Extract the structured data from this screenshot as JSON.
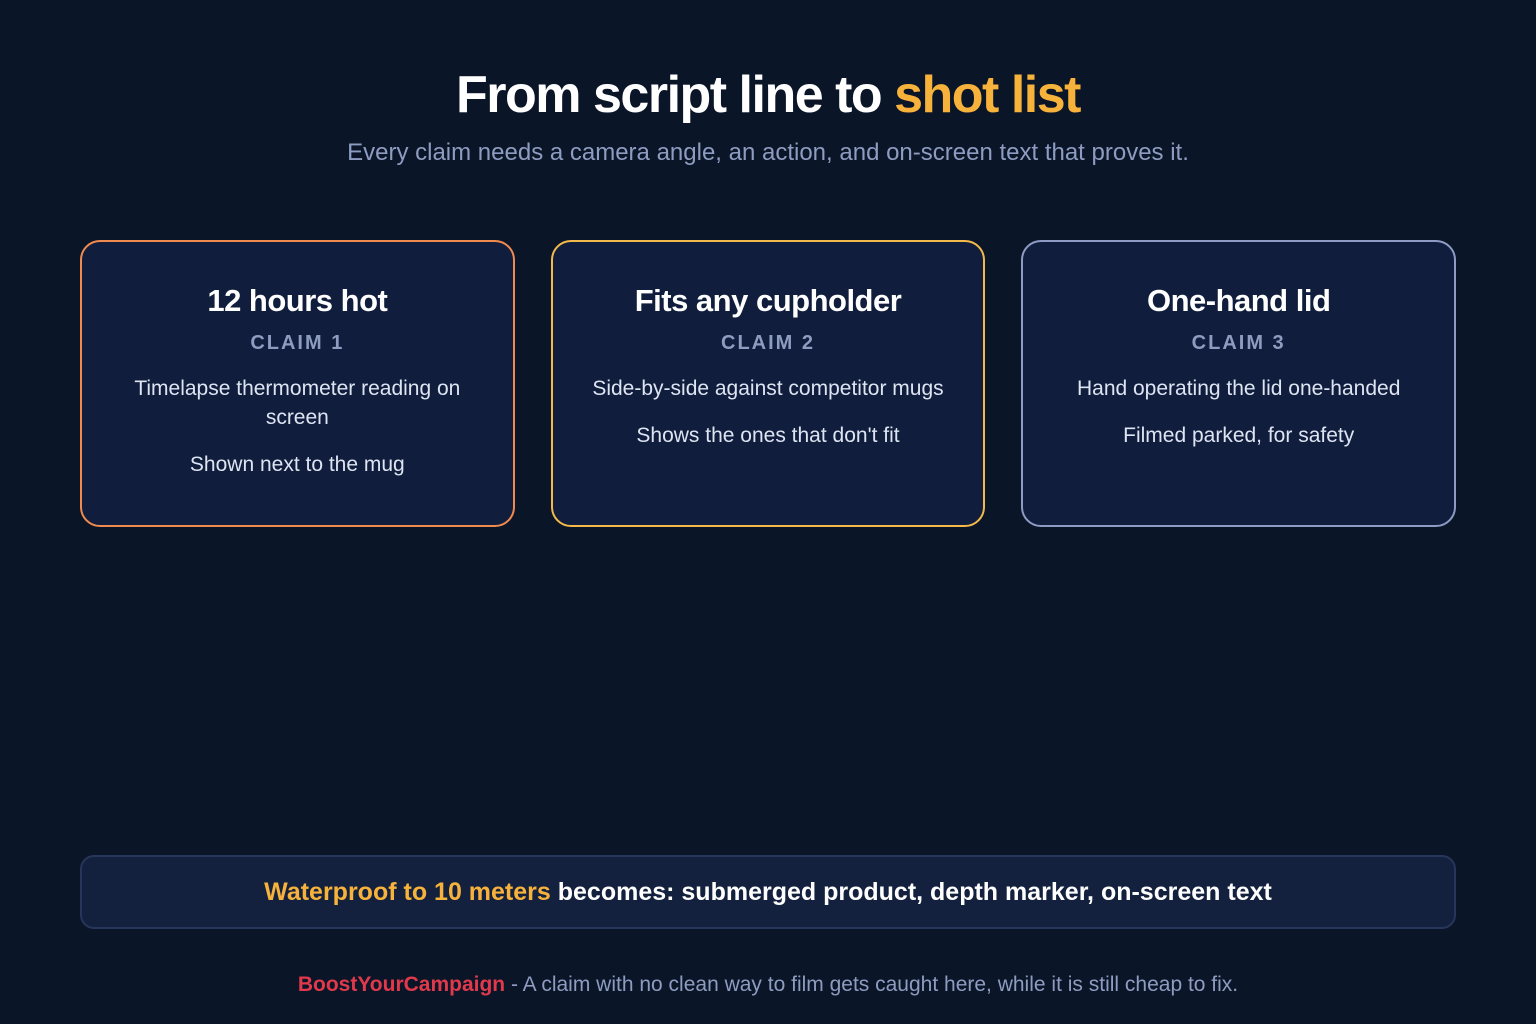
{
  "header": {
    "title_main": "From script line to",
    "title_accent": "shot list",
    "subtitle": "Every claim needs a camera angle, an action, and on-screen text that proves it."
  },
  "cards": [
    {
      "title": "12 hours hot",
      "claim": "CLAIM 1",
      "lines": [
        "Timelapse thermometer reading on screen",
        "Shown next to the mug"
      ],
      "border_color": "#f08a4e"
    },
    {
      "title": "Fits any cupholder",
      "claim": "CLAIM 2",
      "lines": [
        "Side-by-side against competitor mugs",
        "Shows the ones that don't fit"
      ],
      "border_color": "#f3b94a"
    },
    {
      "title": "One-hand lid",
      "claim": "CLAIM 3",
      "lines": [
        "Hand operating the lid one-handed",
        "Filmed parked, for safety"
      ],
      "border_color": "#8e9bc5"
    }
  ],
  "banner": {
    "accent": "Waterproof to 10 meters",
    "text": "becomes: submerged product, depth marker, on-screen text"
  },
  "footer": {
    "brand": "BoostYourCampaign",
    "text": "- A claim with no clean way to film gets caught here, while it is still cheap to fix."
  },
  "colors": {
    "background": "#0b1528",
    "accent": "#f7b23b",
    "brand": "#e0394b",
    "card_background": "#101d3c"
  }
}
